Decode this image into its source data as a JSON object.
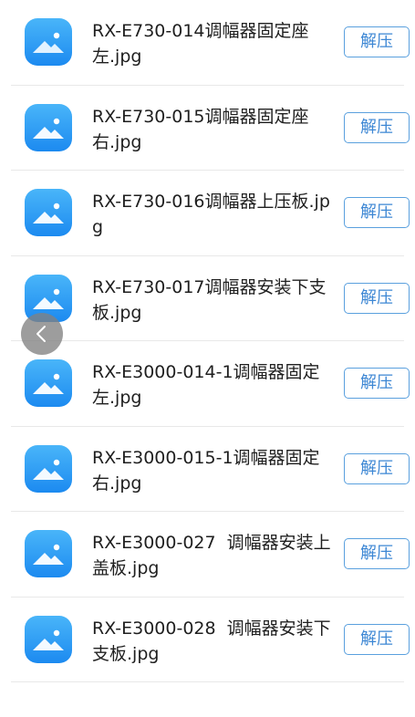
{
  "files": [
    {
      "name": "RX-E730-014调幅器固定座左.jpg",
      "thumbnail_icon": "image-file-icon",
      "action_label": "解压"
    },
    {
      "name": "RX-E730-015调幅器固定座右.jpg",
      "thumbnail_icon": "image-file-icon",
      "action_label": "解压"
    },
    {
      "name": "RX-E730-016调幅器上压板.jpg",
      "thumbnail_icon": "image-file-icon",
      "action_label": "解压"
    },
    {
      "name": "RX-E730-017调幅器安装下支板.jpg",
      "thumbnail_icon": "image-file-icon",
      "action_label": "解压"
    },
    {
      "name": "RX-E3000-014-1调幅器固定左.jpg",
      "thumbnail_icon": "image-file-icon",
      "action_label": "解压"
    },
    {
      "name": "RX-E3000-015-1调幅器固定右.jpg",
      "thumbnail_icon": "image-file-icon",
      "action_label": "解压"
    },
    {
      "name": "RX-E3000-027  调幅器安装上盖板.jpg",
      "thumbnail_icon": "image-file-icon",
      "action_label": "解压"
    },
    {
      "name": "RX-E3000-028  调幅器安装下支板.jpg",
      "thumbnail_icon": "image-file-icon",
      "action_label": "解压"
    }
  ],
  "floating_back_icon": "chevron-left-icon",
  "colors": {
    "accent": "#3d87d4",
    "icon_gradient_top": "#49b5f9",
    "icon_gradient_bottom": "#1c8af0",
    "divider": "#e8e8e8"
  }
}
